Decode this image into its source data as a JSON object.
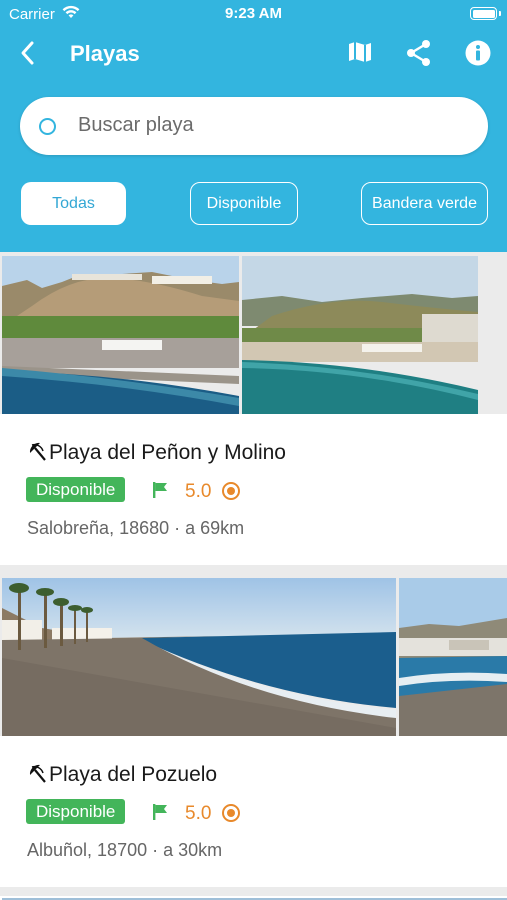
{
  "status_bar": {
    "carrier": "Carrier",
    "time": "9:23 AM"
  },
  "nav": {
    "title": "Playas",
    "icons": [
      "back-chevron-icon",
      "map-icon",
      "share-icon",
      "info-icon"
    ]
  },
  "search": {
    "placeholder": "Buscar playa"
  },
  "filters": [
    {
      "label": "Todas",
      "active": true
    },
    {
      "label": "Disponible",
      "active": false
    },
    {
      "label": "Bandera verde",
      "active": false
    }
  ],
  "beaches": [
    {
      "name": "Playa del Peñon y Molino",
      "status": "Disponible",
      "flag_color": "#43b55a",
      "rating": "5.0",
      "location": "Salobreña, 18680 · a 69km"
    },
    {
      "name": "Playa del Pozuelo",
      "status": "Disponible",
      "flag_color": "#43b55a",
      "rating": "5.0",
      "location": "Albuñol, 18700 · a 30km"
    }
  ],
  "colors": {
    "header": "#33b5df",
    "available_badge": "#43b55a",
    "rating": "#e8892b"
  }
}
